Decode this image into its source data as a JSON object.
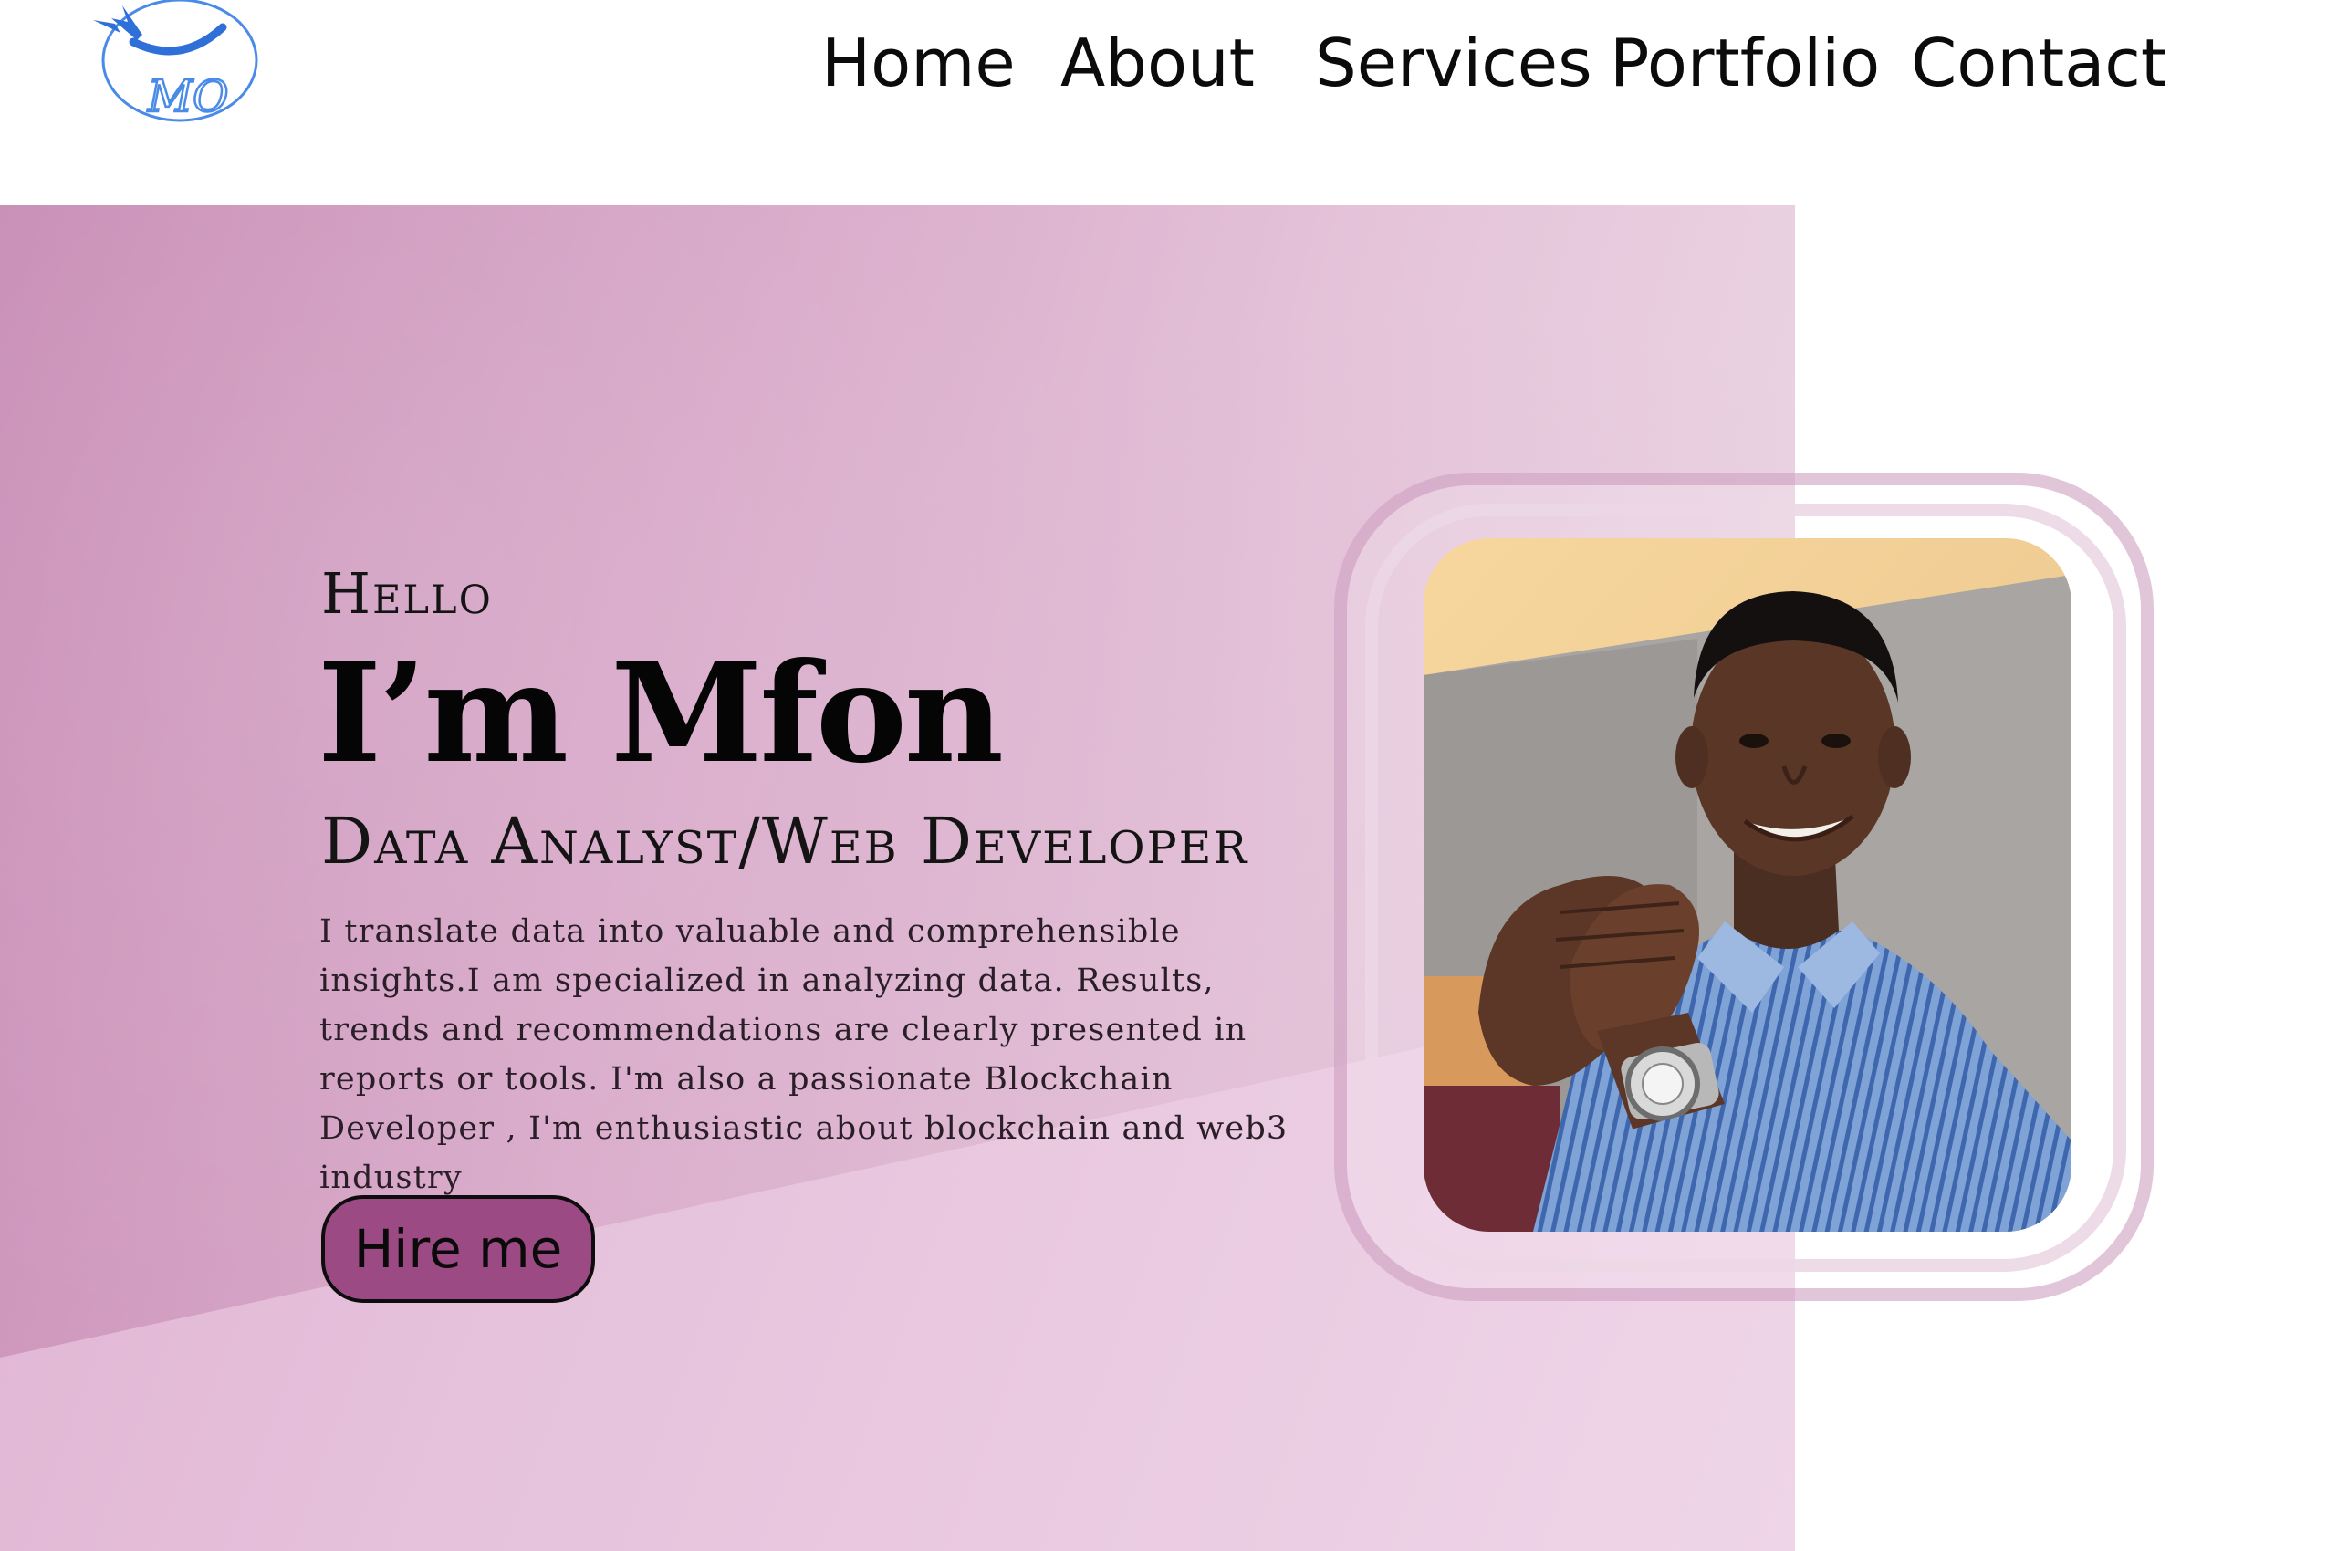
{
  "header": {
    "nav": [
      {
        "label": "Home"
      },
      {
        "label": "About"
      },
      {
        "label": "Services"
      },
      {
        "label": "Portfolio"
      },
      {
        "label": "Contact"
      }
    ]
  },
  "logo": {
    "text": "MO",
    "icon": "hat-logo-icon"
  },
  "hero": {
    "greeting": "Hello",
    "name": "I’m Mfon",
    "role": "Data Analyst/Web Developer",
    "intro": "I translate data into valuable and comprehensible insights.I am specialized in analyzing data. Results, trends and recommendations are clearly presented in reports or tools. I'm also a passionate Blockchain Developer , I'm enthusiastic about blockchain and web3 industry",
    "cta_label": "Hire me"
  },
  "portrait": {
    "subject": "smiling man in blue striped shirt with clasped hands and wristwatch"
  },
  "colors": {
    "accent": "#9b4a84",
    "hero_start": "#c88db5",
    "hero_end": "#eddbe6",
    "logo_blue": "#3f7fe0"
  }
}
